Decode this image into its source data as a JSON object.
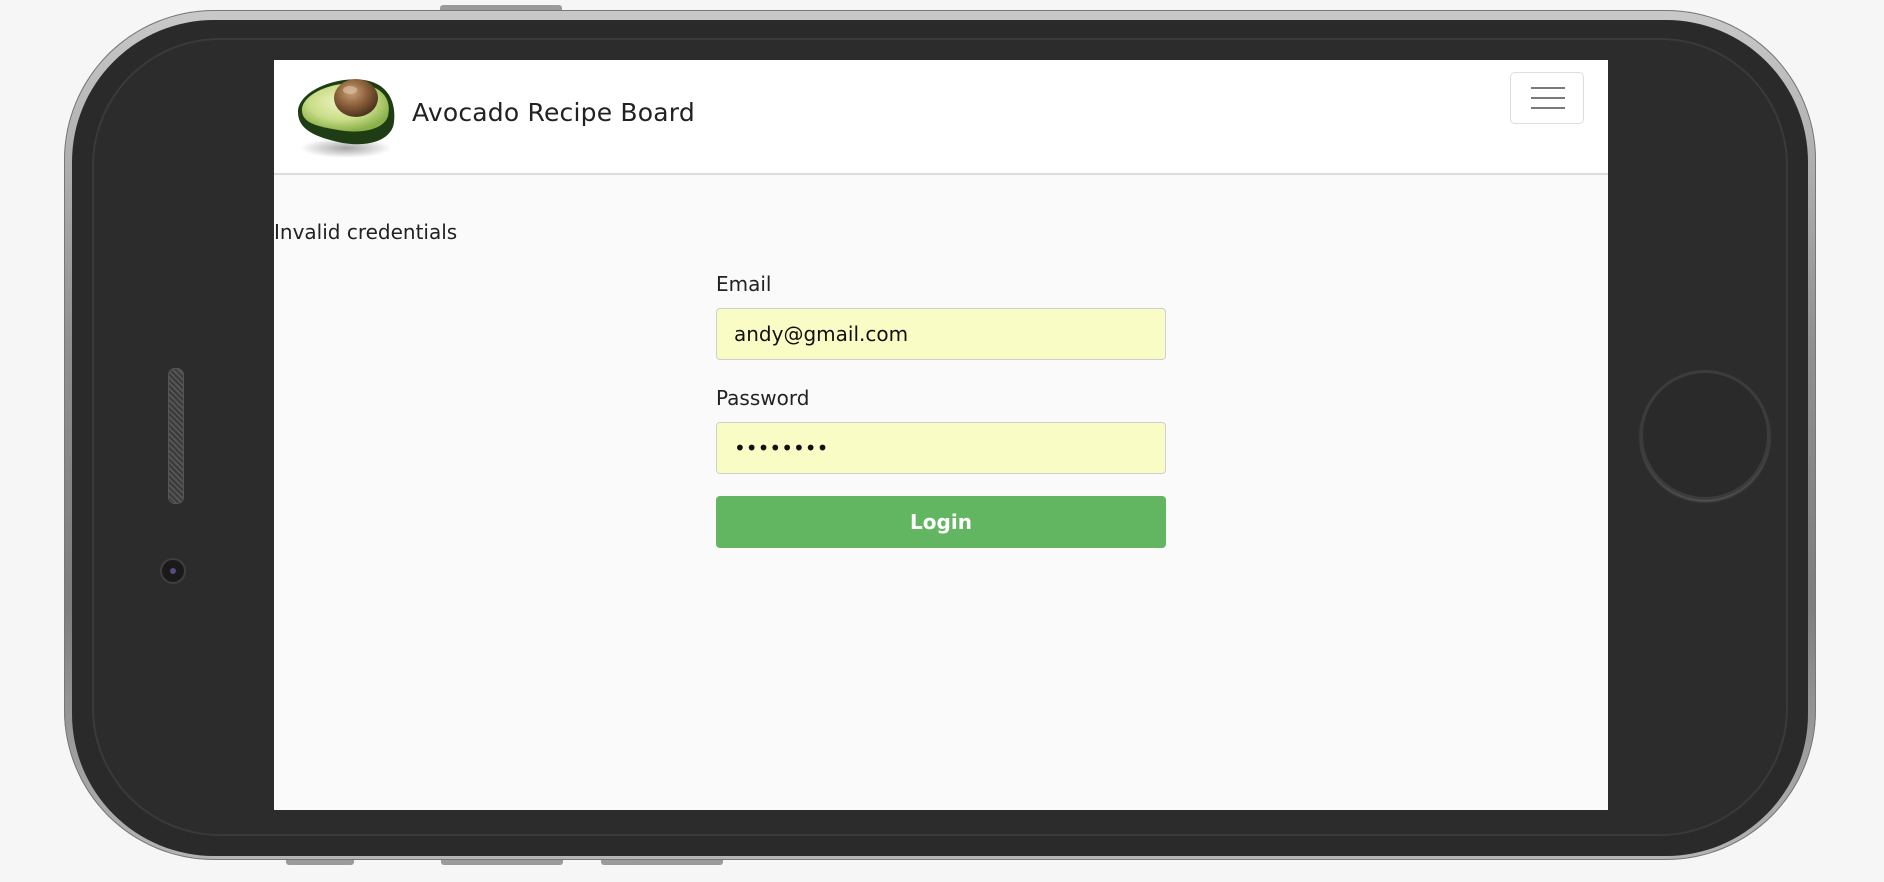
{
  "app": {
    "brand_title": "Avocado Recipe Board",
    "logo_icon": "avocado-logo-icon",
    "menu_icon": "hamburger-menu-icon"
  },
  "alert": {
    "message": "Invalid credentials"
  },
  "login_form": {
    "email_label": "Email",
    "email_value": "andy@gmail.com",
    "password_label": "Password",
    "password_value": "••••••••",
    "submit_label": "Login"
  },
  "colors": {
    "login_button": "#62b662",
    "autofill_input": "#fafcc6",
    "device_frame": "#2c2c2c"
  }
}
